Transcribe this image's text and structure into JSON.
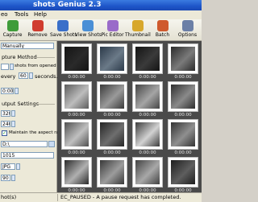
{
  "window": {
    "title": "shots Genius 2.3"
  },
  "menu": [
    "eo",
    "Tools",
    "Help"
  ],
  "toolbar": [
    {
      "label": "Capture",
      "icon": "capture-icon",
      "color": "#3f9c3a"
    },
    {
      "label": "Remove",
      "icon": "remove-icon",
      "color": "#d03c2f"
    },
    {
      "label": "Save Shots",
      "icon": "save-icon",
      "color": "#3a6fc9"
    },
    {
      "label": "View Shots",
      "icon": "view-icon",
      "color": "#4a8fd6"
    },
    {
      "label": "Pic Editor",
      "icon": "pic-editor-icon",
      "color": "#9a6bc9"
    },
    {
      "label": "Thumbnail",
      "icon": "thumbnail-icon",
      "color": "#d7a72c"
    },
    {
      "label": "Batch",
      "icon": "batch-icon",
      "color": "#cf5a2e"
    },
    {
      "label": "Options",
      "icon": "options-icon",
      "color": "#6b7fa6"
    }
  ],
  "panel": {
    "mode_select": "Manually",
    "capture_method_heading": "pture Method",
    "shots_from_file_label": "shots from opened file.",
    "shots_count": "",
    "every_label": "every",
    "every_value": "60",
    "seconds_label": "seconds.",
    "start_time": "0:00",
    "output_heading": "utput Settings",
    "width_value": "320",
    "height_value": "240",
    "maintain_aspect_label": "Maintain the aspect ratio.",
    "folder_value": "D:\\",
    "prefix_value": "1015_",
    "format_value": "JPG",
    "quality_value": "90"
  },
  "thumbnails": [
    {
      "time": "0:00:00",
      "palette": [
        "#141414",
        "#2a2a2a"
      ]
    },
    {
      "time": "0:00:00",
      "palette": [
        "#2c3a4a",
        "#6b7a88"
      ]
    },
    {
      "time": "0:00:00",
      "palette": [
        "#141414",
        "#3a3a3a"
      ]
    },
    {
      "time": "0:00:00",
      "palette": [
        "#2b2b2b",
        "#7a7a7a"
      ]
    },
    {
      "time": "0:00:00",
      "palette": [
        "#5c5c5c",
        "#bdbdbd"
      ]
    },
    {
      "time": "0:00:00",
      "palette": [
        "#3a3a3a",
        "#9a9a9a"
      ]
    },
    {
      "time": "0:00:00",
      "palette": [
        "#454545",
        "#a5a5a5"
      ]
    },
    {
      "time": "0:00:00",
      "palette": [
        "#2e2e2e",
        "#8a8a8a"
      ]
    },
    {
      "time": "0:00:00",
      "palette": [
        "#505050",
        "#c0c0c0"
      ]
    },
    {
      "time": "0:00:00",
      "palette": [
        "#262626",
        "#6e6e6e"
      ]
    },
    {
      "time": "0:00:00",
      "palette": [
        "#3c3c3c",
        "#d2d2d2"
      ]
    },
    {
      "time": "0:00:00",
      "palette": [
        "#333333",
        "#8f8f8f"
      ]
    },
    {
      "time": "0:00:00",
      "palette": [
        "#2a2a2a",
        "#b0b0b0"
      ]
    },
    {
      "time": "0:00:00",
      "palette": [
        "#383838",
        "#9c9c9c"
      ]
    },
    {
      "time": "0:00:00",
      "palette": [
        "#424242",
        "#a8a8a8"
      ]
    },
    {
      "time": "0:00:00",
      "palette": [
        "#1e1e1e",
        "#5e5e5e"
      ]
    }
  ],
  "status": {
    "left": "hot(s)",
    "right": "EC_PAUSED - A pause request has completed."
  }
}
